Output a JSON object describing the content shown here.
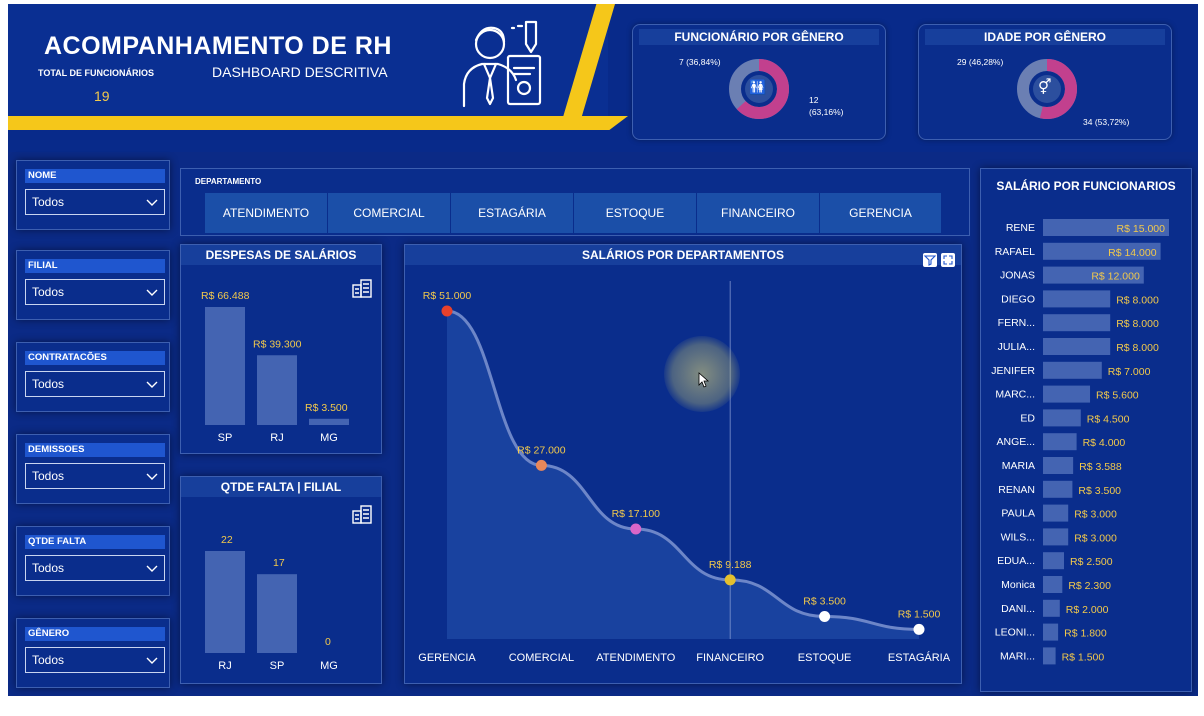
{
  "header": {
    "title": "ACOMPANHAMENTO DE RH",
    "subtitle": "DASHBOARD DESCRITIVA",
    "total_label": "TOTAL DE FUNCIONÁRIOS",
    "total_value": "19"
  },
  "gender_card": {
    "title": "FUNCIONÁRIO POR GÊNERO",
    "slice_a_label": "7 (36,84%)",
    "slice_b_label_1": "12",
    "slice_b_label_2": "(63,16%)",
    "slice_a_value": 36.84,
    "slice_b_value": 63.16,
    "color_a": "#6b7fb3",
    "color_b": "#c2408e"
  },
  "age_card": {
    "title": "IDADE POR GÊNERO",
    "slice_a_label": "29 (46,28%)",
    "slice_b_label": "34 (53,72%)",
    "slice_a_value": 46.28,
    "slice_b_value": 53.72,
    "color_a": "#6b7fb3",
    "color_b": "#c2408e"
  },
  "slicers": [
    {
      "label": "NOME",
      "value": "Todos"
    },
    {
      "label": "FILIAL",
      "value": "Todos"
    },
    {
      "label": "CONTRATACÕES",
      "value": "Todos"
    },
    {
      "label": "DEMISSOES",
      "value": "Todos"
    },
    {
      "label": "QTDE FALTA",
      "value": "Todos"
    },
    {
      "label": "GÊNERO",
      "value": "Todos"
    }
  ],
  "departments": {
    "label": "DEPARTAMENTO",
    "items": [
      "ATENDIMENTO",
      "COMERCIAL",
      "ESTAGÁRIA",
      "ESTOQUE",
      "FINANCEIRO",
      "GERENCIA"
    ]
  },
  "colors": {
    "background": "#0b2a86",
    "accent_yellow": "#f5c71a",
    "value_label": "#f2c94c",
    "bar_fill": "#4f6fb8"
  },
  "chart_data": [
    {
      "type": "bar",
      "title": "DESPESAS DE SALÁRIOS",
      "categories": [
        "SP",
        "RJ",
        "MG"
      ],
      "values": [
        66488,
        39300,
        3500
      ],
      "value_labels": [
        "R$ 66.488",
        "R$ 39.300",
        "R$ 3.500"
      ]
    },
    {
      "type": "bar",
      "title": "QTDE FALTA | FILIAL",
      "categories": [
        "RJ",
        "SP",
        "MG"
      ],
      "values": [
        22,
        17,
        0
      ],
      "value_labels": [
        "22",
        "17",
        "0"
      ]
    },
    {
      "type": "area",
      "title": "SALÁRIOS POR DEPARTAMENTOS",
      "categories": [
        "GERENCIA",
        "COMERCIAL",
        "ATENDIMENTO",
        "FINANCEIRO",
        "ESTOQUE",
        "ESTAGÁRIA"
      ],
      "values": [
        51000,
        27000,
        17100,
        9188,
        3500,
        1500
      ],
      "value_labels": [
        "R$ 51.000",
        "R$ 27.000",
        "R$ 17.100",
        "R$ 9.188",
        "R$ 3.500",
        "R$ 1.500"
      ],
      "point_colors": [
        "#e8412b",
        "#e8875a",
        "#d966c8",
        "#e4c02e",
        "#ffffff",
        "#ffffff"
      ]
    },
    {
      "type": "bar",
      "title": "SALÁRIO POR FUNCIONARIOS",
      "categories": [
        "RENE",
        "RAFAEL",
        "JONAS",
        "DIEGO",
        "FERN...",
        "JULIA...",
        "JENIFER",
        "MARC...",
        "ED",
        "ANGE...",
        "MARIA",
        "RENAN",
        "PAULA",
        "WILS...",
        "EDUA...",
        "Monica",
        "DANI...",
        "LEONI...",
        "MARI..."
      ],
      "values": [
        15000,
        14000,
        12000,
        8000,
        8000,
        8000,
        7000,
        5600,
        4500,
        4000,
        3588,
        3500,
        3000,
        3000,
        2500,
        2300,
        2000,
        1800,
        1500
      ],
      "value_labels": [
        "R$ 15.000",
        "R$ 14.000",
        "R$ 12.000",
        "R$ 8.000",
        "R$ 8.000",
        "R$ 8.000",
        "R$ 7.000",
        "R$ 5.600",
        "R$ 4.500",
        "R$ 4.000",
        "R$ 3.588",
        "R$ 3.500",
        "R$ 3.000",
        "R$ 3.000",
        "R$ 2.500",
        "R$ 2.300",
        "R$ 2.000",
        "R$ 1.800",
        "R$ 1.500"
      ]
    }
  ]
}
